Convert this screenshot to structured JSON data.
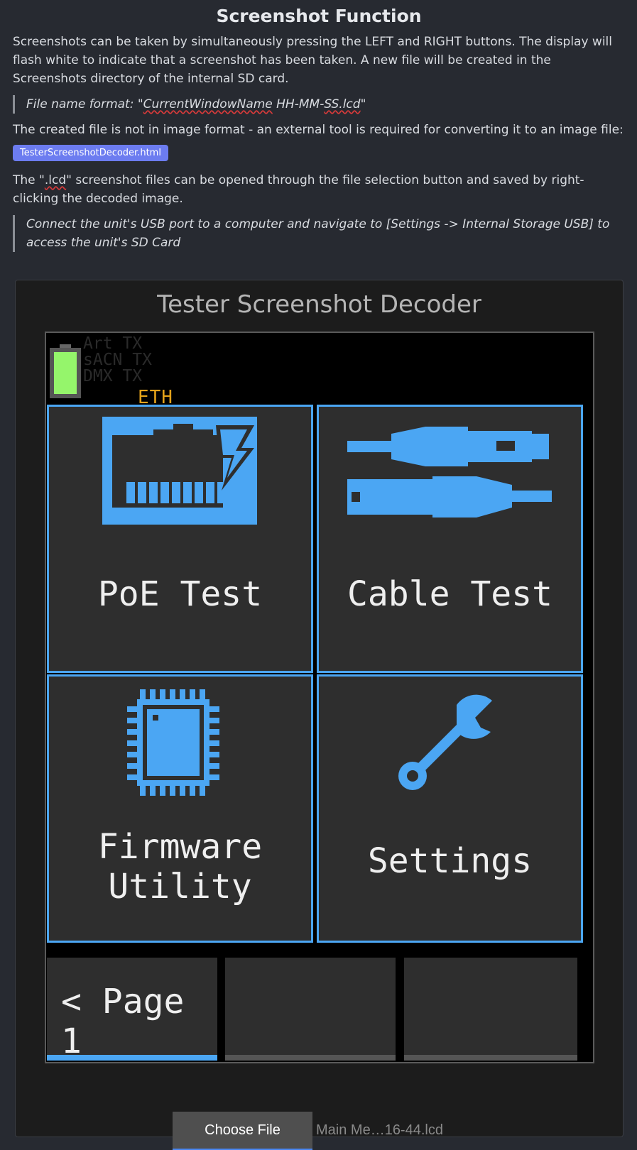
{
  "doc": {
    "title": "Screenshot Function",
    "intro": "Screenshots can be taken by simultaneously pressing the LEFT and RIGHT buttons. The display will flash white to indicate that a screenshot has been taken. A new file will be created in the Screenshots directory of the internal SD card.",
    "note_prefix": "File name format: \"",
    "note_word": "CurrentWindowName",
    "note_mid": " HH-MM-",
    "note_word2": "SS.lcd",
    "note_suffix": "\"",
    "converter_text": "The created file is not in image format - an external tool is required for converting it to an image file:",
    "decoder_link": "TesterScreenshotDecoder.html",
    "open_prefix": "The \"",
    "open_word": ".lcd",
    "open_suffix": "\" screenshot files can be opened through the file selection button and saved by right-clicking the decoded image.",
    "usb_note": "Connect the unit's USB port to a computer and navigate to [Settings -> Internal Storage USB] to access the unit's SD Card"
  },
  "decoder": {
    "title": "Tester Screenshot Decoder",
    "choose_file": "Choose File",
    "file_name": "Main Me…16-44.lcd"
  },
  "screen": {
    "tx_lines": [
      "Art TX",
      "sACN TX",
      "DMX TX"
    ],
    "eth": "ETH",
    "tiles": {
      "poe": "PoE Test",
      "cable": "Cable Test",
      "firmware_1": "Firmware",
      "firmware_2": "Utility",
      "settings": "Settings"
    },
    "page_label": "< Page 1",
    "battery_level": 1.0
  },
  "colors": {
    "accent": "#4ba6f3",
    "eth": "#e3a21a",
    "battery": "#95f56b",
    "link_button": "#6c7cf0"
  }
}
